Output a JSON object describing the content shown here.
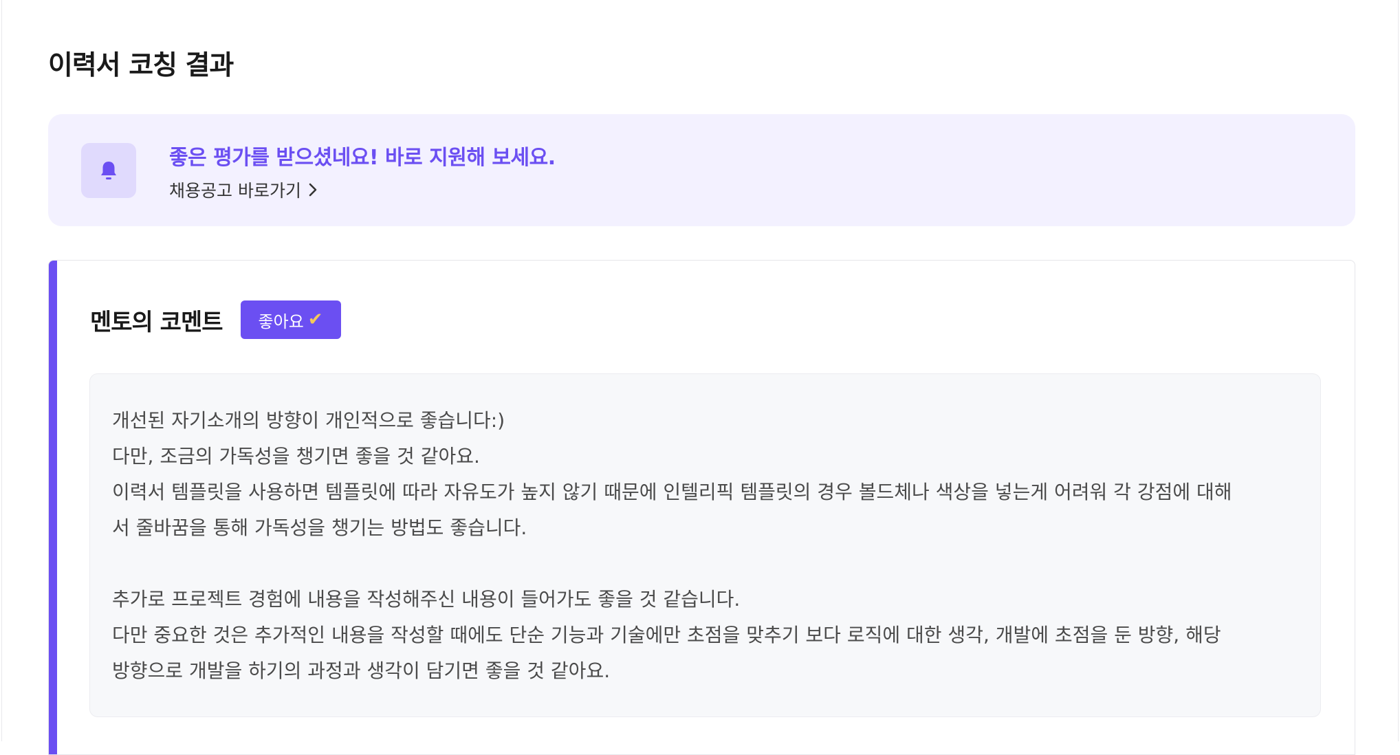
{
  "page": {
    "title": "이력서 코칭 결과"
  },
  "notice": {
    "headline": "좋은 평가를 받으셨네요! 바로 지원해 보세요.",
    "link_label": "채용공고 바로가기",
    "icon": "bell-icon",
    "link_icon": "chevron-right-icon"
  },
  "mentor_comment": {
    "title": "멘토의 코멘트",
    "rating_label": "좋아요",
    "rating_icon": "check-mark-icon",
    "lines": [
      "개선된 자기소개의 방향이 개인적으로 좋습니다:)",
      "다만, 조금의 가독성을 챙기면 좋을 것 같아요.",
      "이력서 템플릿을 사용하면 템플릿에 따라 자유도가 높지 않기 때문에 인텔리픽 템플릿의 경우 볼드체나 색상을 넣는게 어려워 각 강점에 대해",
      "서 줄바꿈을 통해 가독성을 챙기는 방법도 좋습니다.",
      "",
      "추가로 프로젝트 경험에 내용을 작성해주신 내용이 들어가도 좋을 것 같습니다.",
      "다만 중요한 것은 추가적인 내용을 작성할 때에도 단순 기능과 기술에만 초점을 맞추기 보다 로직에 대한 생각, 개발에 초점을 둔 방향, 해당",
      "방향으로 개발을 하기의 과정과 생각이 담기면 좋을 것 같아요."
    ]
  },
  "colors": {
    "accent": "#6b4ff2",
    "notice_bg": "#f3f1ff",
    "comment_bg": "#f7f8fa",
    "check": "#f5c95a"
  }
}
